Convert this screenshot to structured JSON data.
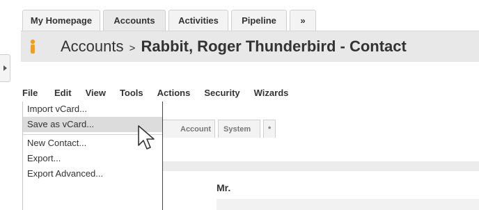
{
  "tabs": [
    {
      "label": "My Homepage"
    },
    {
      "label": "Accounts"
    },
    {
      "label": "Activities"
    },
    {
      "label": "Pipeline"
    },
    {
      "label": "»"
    }
  ],
  "title": {
    "module": "Accounts",
    "separator": ">",
    "record": "Rabbit, Roger Thunderbird - Contact"
  },
  "menubar": [
    {
      "label": "File"
    },
    {
      "label": "Edit"
    },
    {
      "label": "View"
    },
    {
      "label": "Tools"
    },
    {
      "label": "Actions"
    },
    {
      "label": "Security"
    },
    {
      "label": "Wizards"
    }
  ],
  "file_menu": {
    "items": [
      {
        "label": "Import vCard..."
      },
      {
        "label": "Save as vCard..."
      },
      {
        "label": "New Contact..."
      },
      {
        "label": "Export..."
      },
      {
        "label": "Export Advanced..."
      }
    ],
    "hovered_index": 1
  },
  "subtabs": [
    {
      "label": "Account"
    },
    {
      "label": "System"
    },
    {
      "label": "*"
    }
  ],
  "form": {
    "salutation": "Mr."
  },
  "colors": {
    "accent_orange": "#f0a01e",
    "titlebar_bg": "#e8e8e8",
    "hover_bg": "#dcdcdc"
  },
  "icons": {
    "contact": "contact-icon",
    "collapse": "expand-arrow-icon",
    "cursor": "mouse-pointer-icon"
  }
}
